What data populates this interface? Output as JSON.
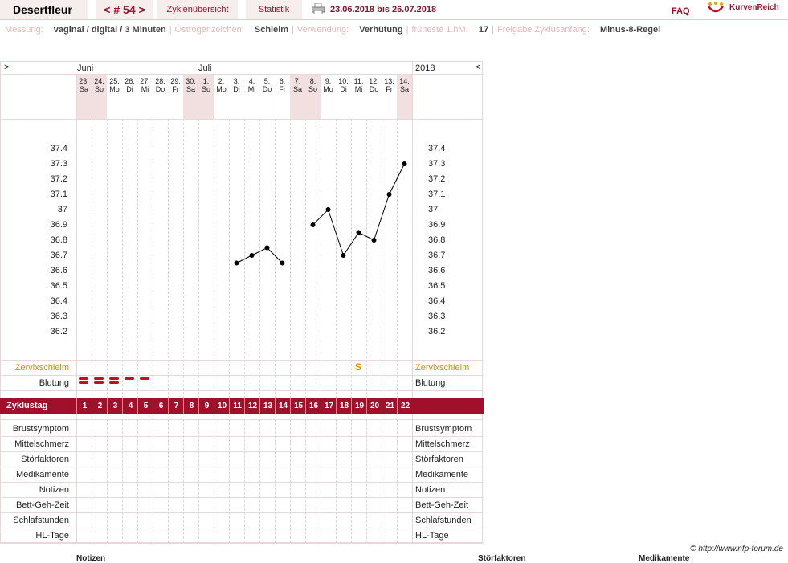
{
  "header": {
    "user": "Desertfleur",
    "cycle_nav": "< # 54 >",
    "tab_overview": "Zyklenübersicht",
    "tab_stats": "Statistik",
    "date_range": "23.06.2018 bis 26.07.2018",
    "faq": "FAQ",
    "logo_text": "KurvenReich"
  },
  "info": [
    {
      "label": "Messung:",
      "value": "vaginal / digital / 3 Minuten"
    },
    {
      "label": "Östrogenzeichen:",
      "value": "Schleim"
    },
    {
      "label": "Verwendung:",
      "value": "Verhütung"
    },
    {
      "label": "früheste 1.hM:",
      "value": "17"
    },
    {
      "label": "Freigabe Zyklusanfang:",
      "value": "Minus-8-Regel"
    }
  ],
  "chart": {
    "nav_left": ">",
    "nav_right": "<",
    "year": "2018",
    "month1": "Juni",
    "month2": "Juli",
    "days": [
      {
        "d": "23.",
        "w": "Sa",
        "we": true
      },
      {
        "d": "24.",
        "w": "So",
        "we": true
      },
      {
        "d": "25.",
        "w": "Mo",
        "we": false
      },
      {
        "d": "26.",
        "w": "Di",
        "we": false
      },
      {
        "d": "27.",
        "w": "Mi",
        "we": false
      },
      {
        "d": "28.",
        "w": "Do",
        "we": false
      },
      {
        "d": "29.",
        "w": "Fr",
        "we": false
      },
      {
        "d": "30.",
        "w": "Sa",
        "we": true
      },
      {
        "d": "1.",
        "w": "So",
        "we": true
      },
      {
        "d": "2.",
        "w": "Mo",
        "we": false
      },
      {
        "d": "3.",
        "w": "Di",
        "we": false
      },
      {
        "d": "4.",
        "w": "Mi",
        "we": false
      },
      {
        "d": "5.",
        "w": "Do",
        "we": false
      },
      {
        "d": "6.",
        "w": "Fr",
        "we": false
      },
      {
        "d": "7.",
        "w": "Sa",
        "we": true
      },
      {
        "d": "8.",
        "w": "So",
        "we": true
      },
      {
        "d": "9.",
        "w": "Mo",
        "we": false
      },
      {
        "d": "10.",
        "w": "Di",
        "we": false
      },
      {
        "d": "11.",
        "w": "Mi",
        "we": false
      },
      {
        "d": "12.",
        "w": "Do",
        "we": false
      },
      {
        "d": "13.",
        "w": "Fr",
        "we": false
      },
      {
        "d": "14.",
        "w": "Sa",
        "we": true
      }
    ],
    "temp_axis": [
      "37.4",
      "37.3",
      "37.2",
      "37.1",
      "37",
      "36.9",
      "36.8",
      "36.7",
      "36.6",
      "36.5",
      "36.4",
      "36.3",
      "36.2"
    ],
    "row_cervix": "Zervixschleim",
    "row_bleeding": "Blutung",
    "row_cycle_day": "Zyklustag",
    "cycle_days": [
      "1",
      "2",
      "3",
      "4",
      "5",
      "6",
      "7",
      "8",
      "9",
      "10",
      "11",
      "12",
      "13",
      "14",
      "15",
      "16",
      "17",
      "18",
      "19",
      "20",
      "21",
      "22"
    ],
    "lower_rows": [
      "Brustsymptom",
      "Mittelschmerz",
      "Störfaktoren",
      "Medikamente",
      "Notizen",
      "Bett-Geh-Zeit",
      "Schlafstunden",
      "HL-Tage"
    ],
    "cervix_marker": "S",
    "accent": "#a0102a"
  },
  "chart_data": {
    "type": "line",
    "x": [
      11,
      12,
      13,
      14,
      16,
      17,
      18,
      19,
      20,
      21,
      22
    ],
    "series": [
      {
        "segments": [
          {
            "x": [
              11,
              12,
              13,
              14
            ],
            "y": [
              36.65,
              36.7,
              36.75,
              36.65
            ]
          },
          {
            "x": [
              16,
              17,
              18,
              19,
              20,
              21,
              22
            ],
            "y": [
              36.9,
              37.0,
              36.7,
              36.85,
              36.8,
              37.1,
              37.3
            ]
          }
        ]
      }
    ],
    "bleeding": [
      {
        "day": 1,
        "level": "strong"
      },
      {
        "day": 2,
        "level": "strong"
      },
      {
        "day": 3,
        "level": "strong"
      },
      {
        "day": 4,
        "level": "light"
      },
      {
        "day": 5,
        "level": "light"
      }
    ],
    "cervix": [
      {
        "day": 19,
        "value": "S"
      }
    ],
    "ylim": [
      36.2,
      37.4
    ]
  },
  "footer": {
    "copyright": "© http://www.nfp-forum.de",
    "col_notes": "Notizen",
    "col_disturb": "Störfaktoren",
    "col_meds": "Medikamente"
  }
}
